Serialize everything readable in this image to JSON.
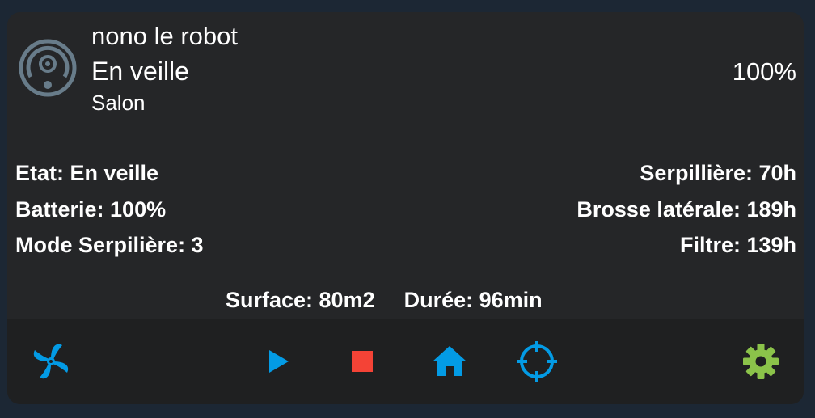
{
  "robot": {
    "name": "nono le robot",
    "status": "En veille",
    "room": "Salon",
    "battery_display": "100%"
  },
  "info": {
    "left": [
      {
        "label": "Etat: En veille"
      },
      {
        "label": "Batterie: 100%"
      },
      {
        "label": "Mode Serpilière: 3"
      }
    ],
    "right": [
      {
        "label": "Serpillière: 70h"
      },
      {
        "label": "Brosse latérale: 189h"
      },
      {
        "label": "Filtre: 139h"
      }
    ]
  },
  "stats": {
    "surface": "Surface: 80m2",
    "duration": "Durée: 96min"
  },
  "toolbar": {
    "buttons": [
      {
        "name": "fan-speed-button",
        "icon": "fan-icon",
        "color": "#039be5"
      },
      {
        "name": "start-button",
        "icon": "play-icon",
        "color": "#039be5"
      },
      {
        "name": "stop-button",
        "icon": "stop-icon",
        "color": "#f44336"
      },
      {
        "name": "return-home-button",
        "icon": "home-icon",
        "color": "#039be5"
      },
      {
        "name": "locate-button",
        "icon": "crosshairs-icon",
        "color": "#039be5"
      },
      {
        "name": "settings-button",
        "icon": "gear-icon",
        "color": "#8bc34a"
      }
    ]
  },
  "colors": {
    "background": "#1c2734",
    "card": "#252628",
    "toolbar": "#1f2021",
    "icon_primary": "#039be5",
    "icon_stop": "#f44336",
    "icon_settings": "#8bc34a",
    "robot_icon": "#687c8a",
    "text": "#ffffff"
  }
}
